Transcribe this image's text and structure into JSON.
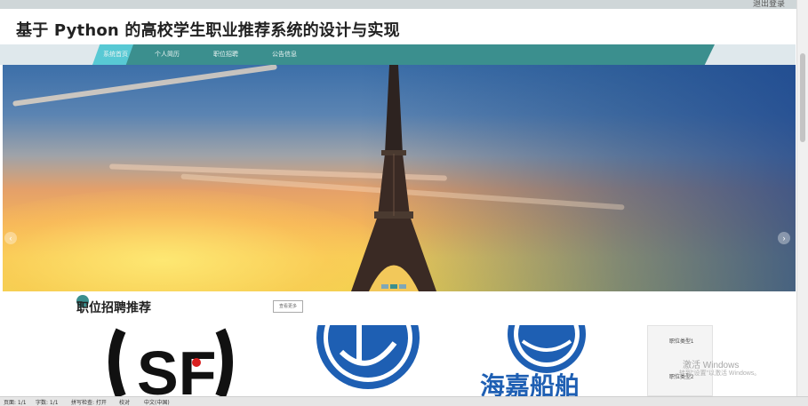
{
  "window": {
    "top_right_text": "退出登录"
  },
  "header": {
    "title": "基于 Python 的高校学生职业推荐系统的设计与实现"
  },
  "nav": {
    "items": [
      {
        "label": "系统首页",
        "active": true
      },
      {
        "label": "个人简历"
      },
      {
        "label": "职位招聘"
      },
      {
        "label": "公告信息"
      }
    ]
  },
  "banner": {
    "left_arrow": "‹",
    "right_arrow": "›",
    "active_slide": 2,
    "slide_count": 3
  },
  "section": {
    "title": "职位招聘推荐",
    "more_label": "查看更多"
  },
  "logos": [
    {
      "name": "sf-express-logo",
      "text": "SF"
    },
    {
      "name": "company-logo-2",
      "text": ""
    },
    {
      "name": "company-logo-3",
      "text": "海嘉船舶"
    }
  ],
  "side_panel": {
    "items": [
      "职位类型1",
      "职位类型2"
    ]
  },
  "watermark": {
    "line1": "激活 Windows",
    "line2": "转到\"设置\"以激活 Windows。"
  },
  "status_bar": {
    "items": [
      "页面: 1/1",
      "字数: 1/1",
      "拼写检查: 打开",
      "校对",
      "中文(中国)"
    ]
  },
  "colors": {
    "nav_band": "#3b8f8e",
    "nav_active": "#58c9d4",
    "accent": "#3b8f8e"
  }
}
